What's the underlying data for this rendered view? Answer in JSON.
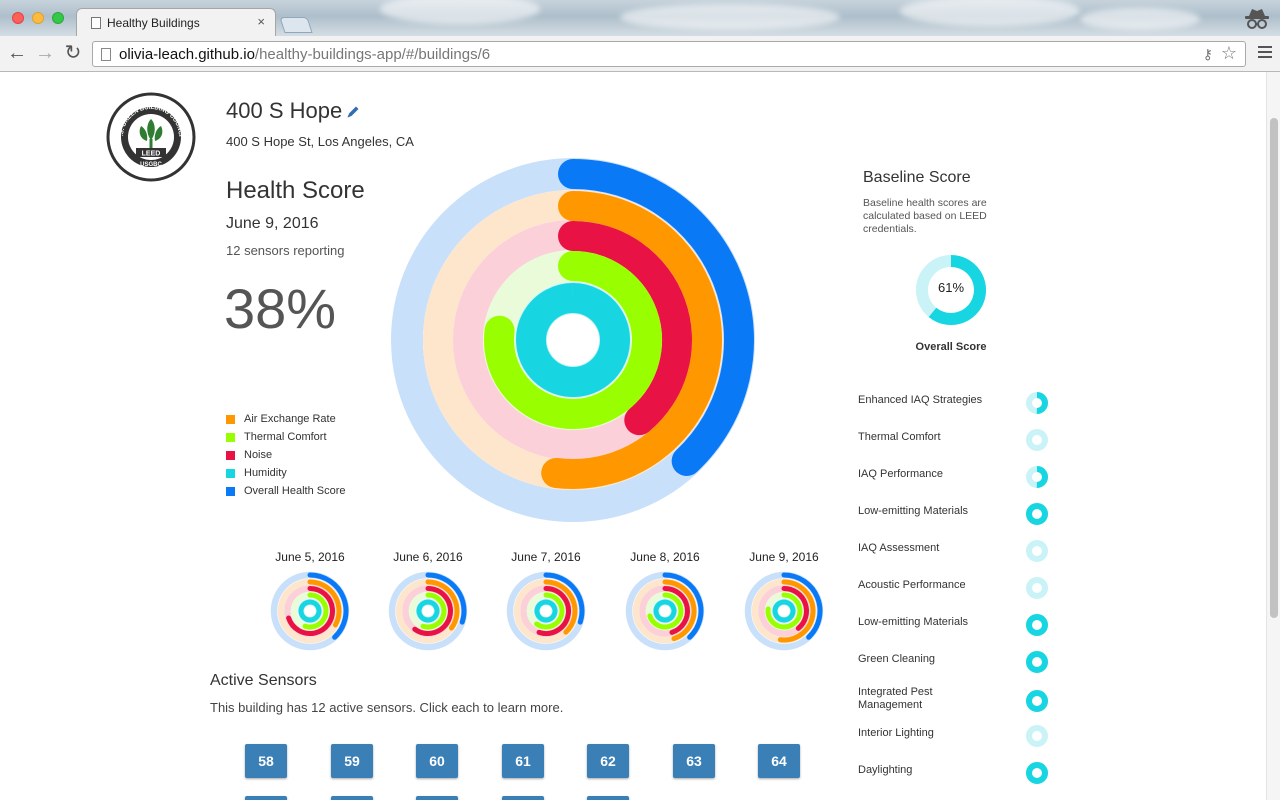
{
  "browser": {
    "tab_title": "Healthy Buildings",
    "tab_close": "×",
    "url_host": "olivia-leach.github.io",
    "url_path": "/healthy-buildings-app/#/buildings/6",
    "back": "←",
    "forward": "→",
    "reload": "↻",
    "key_glyph": "⚷",
    "star_glyph": "☆"
  },
  "logo": {
    "org_name": "U.S. GREEN BUILDING COUNCIL",
    "mark": "LEED",
    "abbr": "USGBC",
    "icon": "usgbc-leaf-logo"
  },
  "building": {
    "name": "400 S Hope",
    "address": "400 S Hope St, Los Angeles, CA"
  },
  "health_score": {
    "title": "Health Score",
    "date": "June 9, 2016",
    "sensors_reporting": "12 sensors reporting",
    "percent_label": "38%"
  },
  "colors": {
    "air": "#ff9800",
    "thermal": "#99ff00",
    "noise": "#e81244",
    "humidity": "#17d6e2",
    "overall": "#0a79f5",
    "air_bg": "#fde6cc",
    "thermal_bg": "#e9fbd8",
    "noise_bg": "#fbd0d9",
    "humidity_bg": "#c9f3f6",
    "overall_bg": "#c9e0fb",
    "sensor_button": "#3a7fb6"
  },
  "legend": [
    {
      "label": "Air Exchange Rate",
      "color": "#ff9800"
    },
    {
      "label": "Thermal Comfort",
      "color": "#99ff00"
    },
    {
      "label": "Noise",
      "color": "#e81244"
    },
    {
      "label": "Humidity",
      "color": "#17d6e2"
    },
    {
      "label": "Overall Health Score",
      "color": "#0a79f5"
    }
  ],
  "current_rings": {
    "overall": 0.38,
    "air": 0.52,
    "noise": 0.39,
    "thermal": 0.77,
    "humidity": 1.0
  },
  "history": [
    {
      "date": "June 5, 2016",
      "overall": 0.38,
      "air": 0.33,
      "noise": 0.7,
      "thermal": 0.55,
      "humidity": 1.0
    },
    {
      "date": "June 6, 2016",
      "overall": 0.3,
      "air": 0.35,
      "noise": 0.6,
      "thermal": 0.55,
      "humidity": 1.0
    },
    {
      "date": "June 7, 2016",
      "overall": 0.3,
      "air": 0.38,
      "noise": 0.55,
      "thermal": 0.6,
      "humidity": 1.0
    },
    {
      "date": "June 8, 2016",
      "overall": 0.38,
      "air": 0.45,
      "noise": 0.45,
      "thermal": 0.7,
      "humidity": 1.0
    },
    {
      "date": "June 9, 2016",
      "overall": 0.38,
      "air": 0.52,
      "noise": 0.39,
      "thermal": 0.77,
      "humidity": 1.0
    }
  ],
  "active_sensors": {
    "title": "Active Sensors",
    "description": "This building has 12 active sensors. Click each to learn more.",
    "ids": [
      "58",
      "59",
      "60",
      "61",
      "62",
      "63",
      "64"
    ]
  },
  "baseline": {
    "title": "Baseline Score",
    "description": "Baseline health scores are calculated based on LEED credentials.",
    "score": 0.61,
    "score_label": "61%",
    "overall_label": "Overall Score",
    "credits": [
      {
        "label": "Enhanced IAQ Strategies",
        "level": 0.5
      },
      {
        "label": "Thermal Comfort",
        "level": 0.0
      },
      {
        "label": "IAQ Performance",
        "level": 0.5
      },
      {
        "label": "Low-emitting Materials",
        "level": 1.0
      },
      {
        "label": "IAQ Assessment",
        "level": 0.0
      },
      {
        "label": "Acoustic Performance",
        "level": 0.0
      },
      {
        "label": "Low-emitting Materials",
        "level": 1.0
      },
      {
        "label": "Green Cleaning",
        "level": 1.0
      },
      {
        "label": "Integrated Pest Management",
        "level": 1.0
      },
      {
        "label": "Interior Lighting",
        "level": 0.0
      },
      {
        "label": "Daylighting",
        "level": 1.0
      }
    ]
  }
}
